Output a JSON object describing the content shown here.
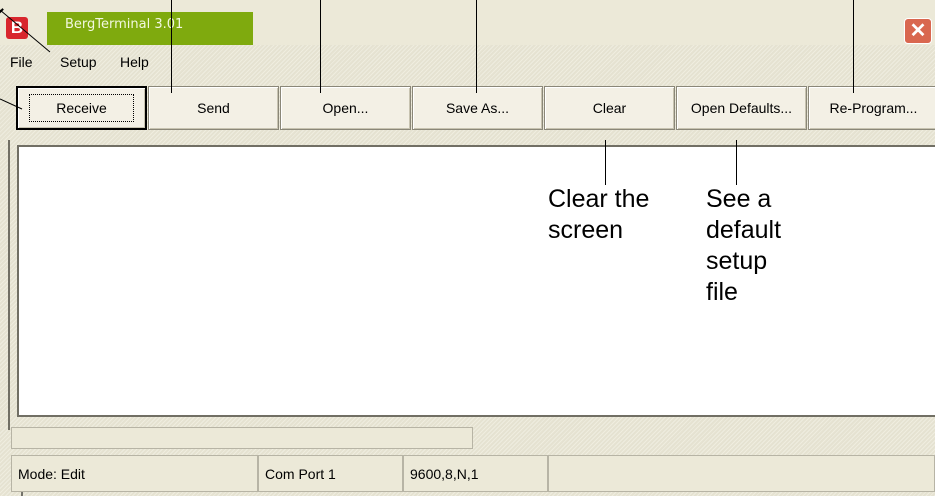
{
  "window": {
    "title": "BergTerminal 3.01",
    "app_icon_letter": "B",
    "close_glyph": "✕"
  },
  "menu": [
    "File",
    "Setup",
    "Help"
  ],
  "toolbar": {
    "receive": "Receive",
    "send": "Send",
    "open": "Open...",
    "save_as": "Save As...",
    "clear": "Clear",
    "open_defaults": "Open Defaults...",
    "reprogram": "Re-Program..."
  },
  "annotations": {
    "clear": "Clear the\nscreen",
    "defaults": "See a\ndefault\nsetup\nfile"
  },
  "status": {
    "mode": "Mode: Edit",
    "port": "Com Port 1",
    "settings": "9600,8,N,1"
  },
  "colors": {
    "title_green": "#7faa0e",
    "icon_red": "#d8262d",
    "close_red": "#d9674f",
    "window_bg": "#ece9d8"
  }
}
